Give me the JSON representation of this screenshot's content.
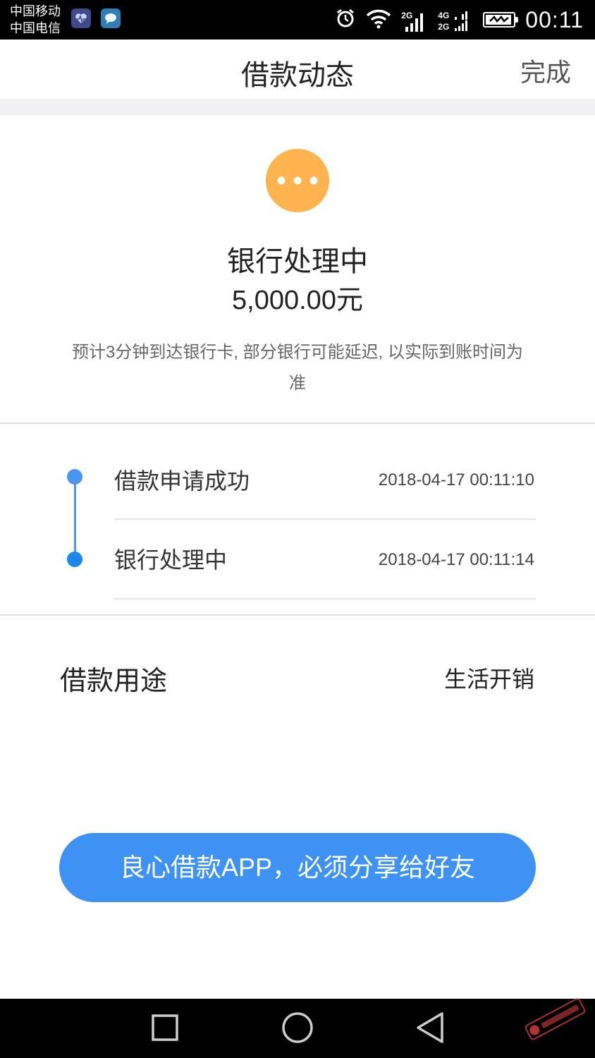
{
  "status_bar": {
    "carrier_1": "中国移动",
    "carrier_2": "中国电信",
    "signal_1_label": "2G",
    "signal_2_label_top": "4G",
    "signal_2_label_bottom": "2G",
    "time": "00:11",
    "icons": [
      "health-app-icon",
      "message-app-icon",
      "alarm-icon",
      "wifi-icon",
      "signal-icon",
      "battery-charging-icon"
    ]
  },
  "header": {
    "title": "借款动态",
    "done_label": "完成"
  },
  "status": {
    "icon": "ellipsis-pending-icon",
    "icon_color": "#fdb44e",
    "title": "银行处理中",
    "amount": "5,000.00元",
    "note": "预计3分钟到达银行卡, 部分银行可能延迟, 以实际到账时间为准"
  },
  "timeline": {
    "accent_color": "#4a95ee",
    "items": [
      {
        "label": "借款申请成功",
        "time": "2018-04-17 00:11:10"
      },
      {
        "label": "银行处理中",
        "time": "2018-04-17 00:11:14"
      }
    ]
  },
  "purpose": {
    "label": "借款用途",
    "value": "生活开销"
  },
  "share_button": {
    "label": "良心借款APP，必须分享给好友",
    "color": "#3d92f4"
  },
  "nav_bar": {
    "icons": [
      "recents-square-icon",
      "home-circle-icon",
      "back-triangle-icon"
    ]
  }
}
